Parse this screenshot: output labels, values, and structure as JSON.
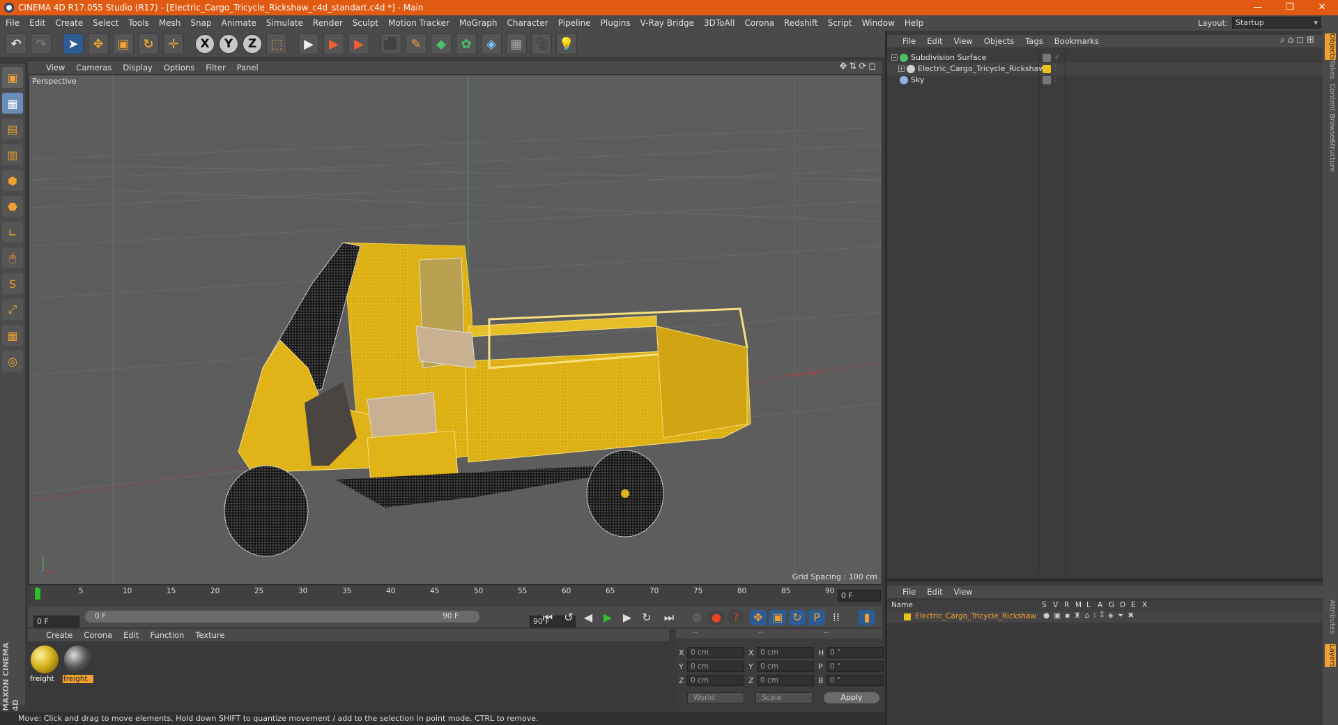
{
  "title": "CINEMA 4D R17.055 Studio (R17) - [Electric_Cargo_Tricycle_Rickshaw_c4d_standart.c4d *] - Main",
  "window_buttons": [
    "—",
    "❐",
    "✕"
  ],
  "menu": [
    "File",
    "Edit",
    "Create",
    "Select",
    "Tools",
    "Mesh",
    "Snap",
    "Animate",
    "Simulate",
    "Render",
    "Sculpt",
    "Motion Tracker",
    "MoGraph",
    "Character",
    "Pipeline",
    "Plugins",
    "V-Ray Bridge",
    "3DToAll",
    "Corona",
    "Redshift",
    "Script",
    "Window",
    "Help"
  ],
  "layout": {
    "label": "Layout:",
    "value": "Startup"
  },
  "toolbar": {
    "undo": "↶",
    "redo": "↷",
    "select": "➤",
    "move": "✥",
    "scale": "▣",
    "rotate": "↻",
    "live": "✛",
    "x": "X",
    "y": "Y",
    "z": "Z",
    "coord": "⬚",
    "render_view": "▶",
    "render_pic": "▶",
    "render_settings": "▶",
    "cube": "⬛",
    "pen": "✎",
    "subdiv": "◆",
    "array": "✿",
    "deform": "◈",
    "floor": "▦",
    "camera": "🎥",
    "light": "💡"
  },
  "left_tools": [
    "▣",
    "▦",
    "▤",
    "▥",
    "⬢",
    "⬣",
    "∟",
    "🖱",
    "S",
    "⤢",
    "▦",
    "◎"
  ],
  "maxon_logo": "MAXON CINEMA 4D",
  "viewport": {
    "menu": [
      "View",
      "Cameras",
      "Display",
      "Options",
      "Filter",
      "Panel"
    ],
    "nav_icons": "✥⇅⟳◻",
    "camera_label": "Perspective",
    "grid_spacing": "Grid Spacing : 100 cm"
  },
  "timeline": {
    "ticks": [
      "0",
      "5",
      "10",
      "15",
      "20",
      "25",
      "30",
      "35",
      "40",
      "45",
      "50",
      "55",
      "60",
      "65",
      "70",
      "75",
      "80",
      "85",
      "90"
    ],
    "current_frame": "0 F"
  },
  "transport": {
    "start_field": "0 F",
    "range_start": "0 F",
    "range_end": "90 F",
    "end_field": "90 F",
    "buttons": [
      "⏮",
      "↺",
      "◀",
      "▶",
      "▶",
      "↻",
      "⏭"
    ],
    "key_buttons": [
      "⊘",
      "●",
      "?",
      "✥",
      "▣",
      "↻",
      "P",
      "⁞⁞"
    ]
  },
  "material_manager": {
    "menu": [
      "Create",
      "Corona",
      "Edit",
      "Function",
      "Texture"
    ],
    "materials": [
      {
        "name": "freight",
        "color": "#d6b21c"
      },
      {
        "name": "freight",
        "color": "#5a5a5a"
      }
    ]
  },
  "coordinates": {
    "header": [
      "--",
      "--",
      "--"
    ],
    "rows": [
      {
        "a": "X",
        "av": "0 cm",
        "b": "X",
        "bv": "0 cm",
        "c": "H",
        "cv": "0 °"
      },
      {
        "a": "Y",
        "av": "0 cm",
        "b": "Y",
        "bv": "0 cm",
        "c": "P",
        "cv": "0 °"
      },
      {
        "a": "Z",
        "av": "0 cm",
        "b": "Z",
        "bv": "0 cm",
        "c": "B",
        "cv": "0 °"
      }
    ],
    "world": "World",
    "scale": "Scale",
    "apply": "Apply"
  },
  "status": "Move: Click and drag to move elements. Hold down SHIFT to quantize movement / add to the selection in point mode, CTRL to remove.",
  "object_manager": {
    "menu": [
      "File",
      "Edit",
      "View",
      "Objects",
      "Tags",
      "Bookmarks"
    ],
    "icons": "⌕⌂◻⊞",
    "objects": [
      {
        "name": "Subdivision Surface",
        "icon_color": "#4ac06a",
        "level": 0,
        "expander": "−"
      },
      {
        "name": "Electric_Cargo_Tricycle_Rickshaw",
        "icon_color": "#cfcfcf",
        "level": 1,
        "expander": "+"
      },
      {
        "name": "Sky",
        "icon_color": "#8fb0e0",
        "level": 0,
        "expander": ""
      }
    ]
  },
  "side_tabs": [
    "Objects",
    "Takes",
    "Content Browser",
    "Structure"
  ],
  "side_tabs_lower": [
    "Attributes",
    "Layers"
  ],
  "layer_manager": {
    "menu": [
      "File",
      "Edit",
      "View"
    ],
    "columns": [
      "Name",
      "S",
      "V",
      "R",
      "M",
      "L",
      "A",
      "G",
      "D",
      "E",
      "X"
    ],
    "layer": {
      "name": "Electric_Cargo_Tricycle_Rickshaw",
      "color": "#e8c21a"
    }
  }
}
